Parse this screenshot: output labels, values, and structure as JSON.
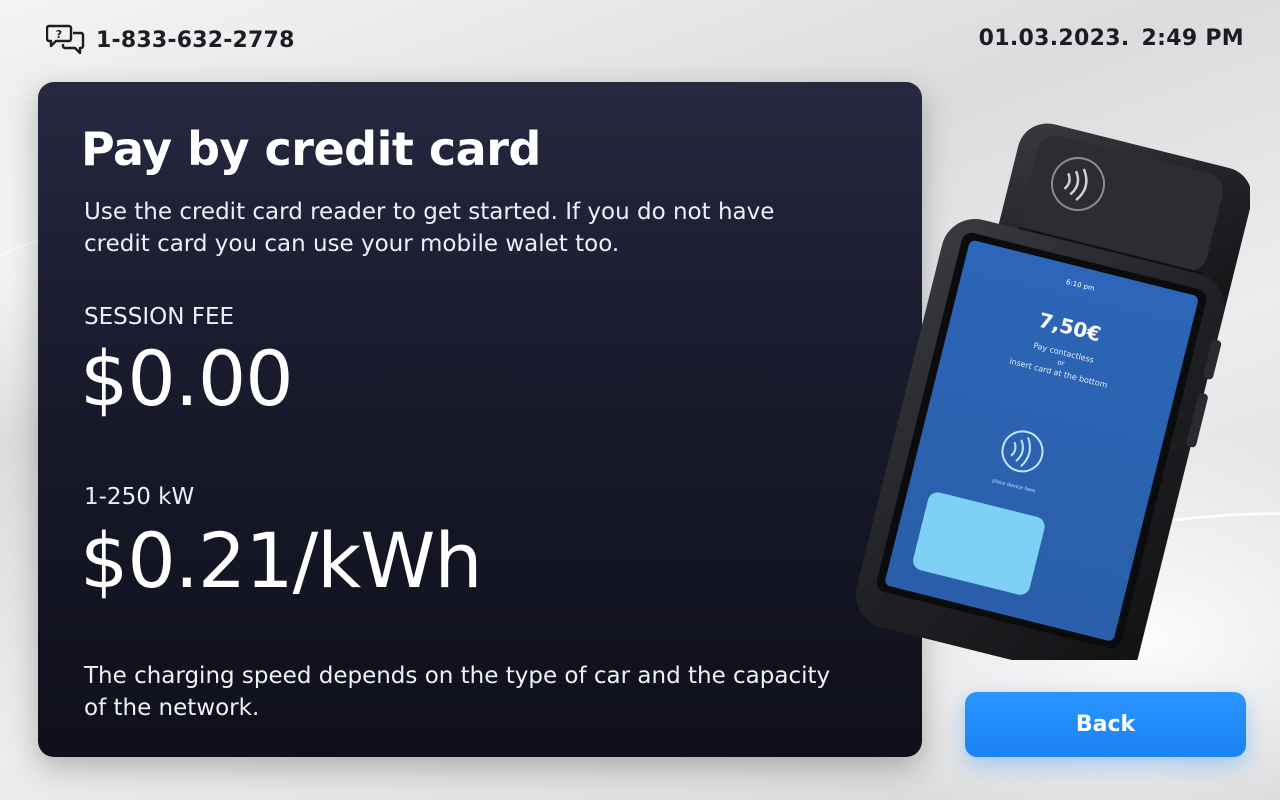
{
  "header": {
    "support_icon": "chat-help-icon",
    "phone": "1-833-632-2778",
    "date": "01.03.2023.",
    "time": "2:49 PM"
  },
  "panel": {
    "title": "Pay by credit card",
    "description": "Use the credit card reader to get started. If you do not have credit card you can use your mobile walet too.",
    "session_fee_label": "SESSION FEE",
    "session_fee_value": "$0.00",
    "rate_label": "1-250 kW",
    "rate_value": "$0.21/kWh",
    "note": "The charging speed depends on the type of car and the capacity of the network."
  },
  "terminal": {
    "screen_time": "6:10 pm",
    "screen_amount": "7,50€",
    "screen_line1": "Pay contactless",
    "screen_line2": "or",
    "screen_line3": "insert card at the bottom",
    "screen_hint": "place device here",
    "icons": [
      "contactless-icon"
    ]
  },
  "actions": {
    "back_label": "Back"
  },
  "colors": {
    "panel_bg": "#1a1b2e",
    "accent_button": "#1a82f5",
    "terminal_screen": "#2f63b3"
  }
}
